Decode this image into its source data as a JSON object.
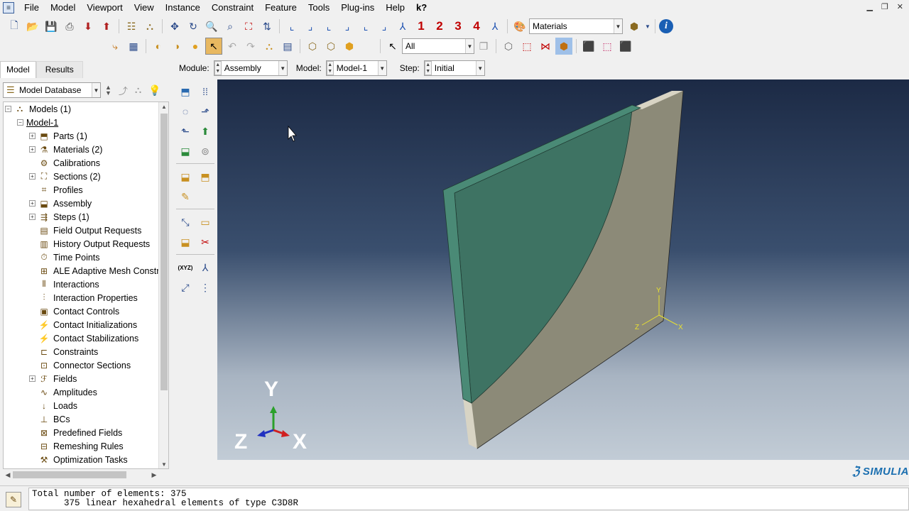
{
  "menu": {
    "items": [
      "File",
      "Model",
      "Viewport",
      "View",
      "Instance",
      "Constraint",
      "Feature",
      "Tools",
      "Plug-ins",
      "Help"
    ],
    "help_icon": "k?"
  },
  "toolbar1": {
    "view_numbers": [
      "1",
      "2",
      "3",
      "4"
    ],
    "materials_combo": "Materials"
  },
  "toolbar2": {
    "selection_filter": "All"
  },
  "context": {
    "module_label": "Module:",
    "module_value": "Assembly",
    "model_label": "Model:",
    "model_value": "Model-1",
    "step_label": "Step:",
    "step_value": "Initial"
  },
  "tabs": {
    "model": "Model",
    "results": "Results"
  },
  "tree": {
    "database_combo": "Model Database",
    "root": "Models (1)",
    "model": "Model-1",
    "items": [
      {
        "label": "Parts (1)",
        "expandable": true,
        "icon": "parts-icon"
      },
      {
        "label": "Materials (2)",
        "expandable": true,
        "icon": "materials-icon"
      },
      {
        "label": "Calibrations",
        "expandable": false,
        "icon": "calibrations-icon"
      },
      {
        "label": "Sections (2)",
        "expandable": true,
        "icon": "sections-icon"
      },
      {
        "label": "Profiles",
        "expandable": false,
        "icon": "profiles-icon"
      },
      {
        "label": "Assembly",
        "expandable": true,
        "icon": "assembly-icon"
      },
      {
        "label": "Steps (1)",
        "expandable": true,
        "icon": "steps-icon"
      },
      {
        "label": "Field Output Requests",
        "expandable": false,
        "icon": "field-output-icon"
      },
      {
        "label": "History Output Requests",
        "expandable": false,
        "icon": "history-output-icon"
      },
      {
        "label": "Time Points",
        "expandable": false,
        "icon": "time-points-icon"
      },
      {
        "label": "ALE Adaptive Mesh Constra",
        "expandable": false,
        "icon": "ale-mesh-icon"
      },
      {
        "label": "Interactions",
        "expandable": false,
        "icon": "interactions-icon"
      },
      {
        "label": "Interaction Properties",
        "expandable": false,
        "icon": "interaction-properties-icon"
      },
      {
        "label": "Contact Controls",
        "expandable": false,
        "icon": "contact-controls-icon"
      },
      {
        "label": "Contact Initializations",
        "expandable": false,
        "icon": "contact-initializations-icon"
      },
      {
        "label": "Contact Stabilizations",
        "expandable": false,
        "icon": "contact-stabilizations-icon"
      },
      {
        "label": "Constraints",
        "expandable": false,
        "icon": "constraints-icon"
      },
      {
        "label": "Connector Sections",
        "expandable": false,
        "icon": "connector-sections-icon"
      },
      {
        "label": "Fields",
        "expandable": true,
        "icon": "fields-icon"
      },
      {
        "label": "Amplitudes",
        "expandable": false,
        "icon": "amplitudes-icon"
      },
      {
        "label": "Loads",
        "expandable": false,
        "icon": "loads-icon"
      },
      {
        "label": "BCs",
        "expandable": false,
        "icon": "bcs-icon"
      },
      {
        "label": "Predefined Fields",
        "expandable": false,
        "icon": "predefined-fields-icon"
      },
      {
        "label": "Remeshing Rules",
        "expandable": false,
        "icon": "remeshing-rules-icon"
      },
      {
        "label": "Optimization Tasks",
        "expandable": false,
        "icon": "optimization-tasks-icon"
      }
    ]
  },
  "viewport": {
    "triad_small": {
      "x": "X",
      "y": "Y",
      "z": "Z"
    },
    "triad_large": {
      "x": "X",
      "y": "Y",
      "z": "Z"
    },
    "colors": {
      "part_face": "#3e7363",
      "part_edge": "#4a8a76",
      "part_side": "#8c8a78",
      "part_top": "#d8d4c4"
    }
  },
  "branding": "SIMULIA",
  "messages": {
    "line1": "Total number of elements: 375",
    "line2": "      375 linear hexahedral elements of type C3D8R"
  }
}
